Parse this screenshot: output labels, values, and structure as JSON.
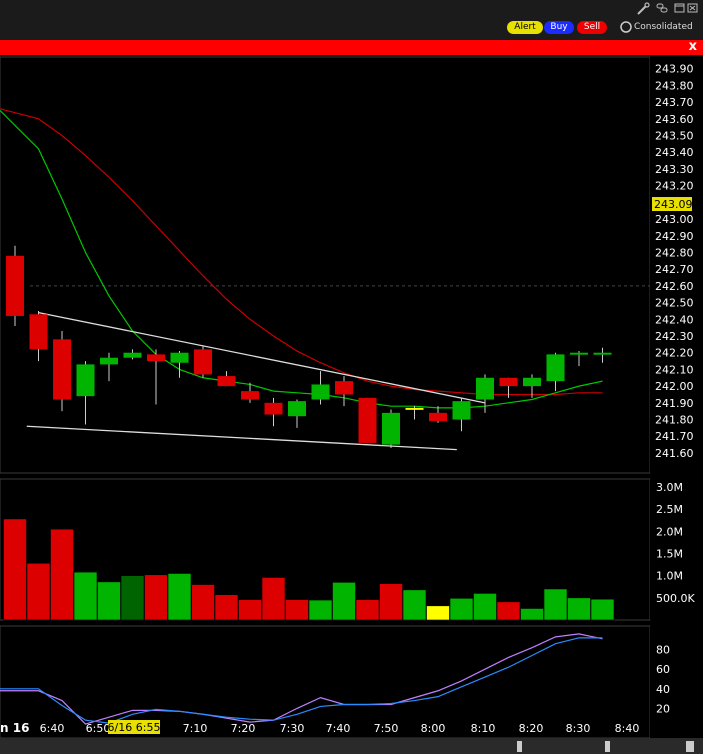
{
  "toolbar": {
    "alert_label": "Alert",
    "buy_label": "Buy",
    "sell_label": "Sell",
    "consolidated_label": "Consolidated",
    "close_glyph": "x"
  },
  "icons": [
    "wrench-icon",
    "link-icon",
    "window-icon",
    "close-icon"
  ],
  "colors": {
    "up": "#00b400",
    "down": "#dd0000",
    "ema_fast": "#00c800",
    "ema_slow": "#c80000",
    "stoch_k": "#c080ff",
    "stoch_d": "#2a8cff",
    "highlight": "#ffff00"
  },
  "chart_data": [
    {
      "type": "candlestick",
      "current_price": "243.09",
      "y_ticks": [
        "243.90",
        "243.80",
        "243.70",
        "243.60",
        "243.50",
        "243.40",
        "243.30",
        "243.20",
        "243.00",
        "242.90",
        "242.80",
        "242.70",
        "242.60",
        "242.50",
        "242.40",
        "242.30",
        "242.20",
        "242.10",
        "242.00",
        "241.90",
        "241.80",
        "241.70",
        "241.60"
      ],
      "ylim": [
        241.48,
        243.97
      ],
      "x_ticks": [
        "6:40",
        "6:50",
        "7:10",
        "7:20",
        "7:30",
        "7:40",
        "7:50",
        "8:00",
        "8:10",
        "8:20",
        "8:30",
        "8:40"
      ],
      "x_partial_label": "n 16",
      "crosshair_label": "6/16 6:55",
      "candles": [
        {
          "o": 242.78,
          "h": 242.84,
          "l": 242.36,
          "c": 242.42
        },
        {
          "o": 242.43,
          "h": 242.45,
          "l": 242.15,
          "c": 242.22
        },
        {
          "o": 242.28,
          "h": 242.33,
          "l": 241.85,
          "c": 241.92
        },
        {
          "o": 241.94,
          "h": 242.15,
          "l": 241.77,
          "c": 242.13
        },
        {
          "o": 242.13,
          "h": 242.2,
          "l": 242.03,
          "c": 242.17
        },
        {
          "o": 242.17,
          "h": 242.22,
          "l": 242.16,
          "c": 242.2
        },
        {
          "o": 242.19,
          "h": 242.22,
          "l": 241.89,
          "c": 242.15
        },
        {
          "o": 242.14,
          "h": 242.21,
          "l": 242.05,
          "c": 242.2
        },
        {
          "o": 242.22,
          "h": 242.24,
          "l": 242.05,
          "c": 242.07
        },
        {
          "o": 242.06,
          "h": 242.09,
          "l": 242.0,
          "c": 242.0
        },
        {
          "o": 241.97,
          "h": 242.02,
          "l": 241.9,
          "c": 241.92
        },
        {
          "o": 241.9,
          "h": 241.93,
          "l": 241.76,
          "c": 241.83
        },
        {
          "o": 241.82,
          "h": 241.92,
          "l": 241.75,
          "c": 241.91
        },
        {
          "o": 241.92,
          "h": 242.09,
          "l": 241.89,
          "c": 242.01
        },
        {
          "o": 242.03,
          "h": 242.06,
          "l": 241.88,
          "c": 241.95
        },
        {
          "o": 241.93,
          "h": 241.93,
          "l": 241.66,
          "c": 241.66
        },
        {
          "o": 241.65,
          "h": 241.86,
          "l": 241.63,
          "c": 241.84
        },
        {
          "o": 241.86,
          "h": 241.88,
          "l": 241.8,
          "c": 241.87
        },
        {
          "o": 241.84,
          "h": 241.88,
          "l": 241.78,
          "c": 241.79
        },
        {
          "o": 241.8,
          "h": 241.93,
          "l": 241.73,
          "c": 241.91
        },
        {
          "o": 241.92,
          "h": 242.07,
          "l": 241.84,
          "c": 242.05
        },
        {
          "o": 242.05,
          "h": 242.05,
          "l": 241.93,
          "c": 242.0
        },
        {
          "o": 242.0,
          "h": 242.07,
          "l": 241.93,
          "c": 242.05
        },
        {
          "o": 242.03,
          "h": 242.2,
          "l": 241.97,
          "c": 242.19
        },
        {
          "o": 242.19,
          "h": 242.21,
          "l": 242.12,
          "c": 242.2
        },
        {
          "o": 242.2,
          "h": 242.23,
          "l": 242.14,
          "c": 242.2
        }
      ],
      "ema_fast": [
        243.65,
        243.42,
        243.12,
        242.8,
        242.54,
        242.33,
        242.19,
        242.1,
        242.05,
        242.03,
        242.01,
        241.97,
        241.96,
        241.95,
        241.93,
        241.9,
        241.88,
        241.88,
        241.87,
        241.87,
        241.88,
        241.9,
        241.92,
        241.96,
        242.0,
        242.03
      ],
      "ema_slow": [
        243.66,
        243.6,
        243.5,
        243.38,
        243.25,
        243.11,
        242.96,
        242.81,
        242.66,
        242.52,
        242.4,
        242.3,
        242.21,
        242.14,
        242.08,
        242.03,
        242.0,
        241.98,
        241.97,
        241.96,
        241.95,
        241.95,
        241.95,
        241.95,
        241.96,
        241.96
      ],
      "trendlines": [
        {
          "from": [
            1,
            242.44
          ],
          "to": [
            20,
            241.9
          ]
        },
        {
          "from": [
            0.5,
            241.76
          ],
          "to": [
            18.8,
            241.62
          ]
        }
      ]
    },
    {
      "type": "bar",
      "y_ticks": [
        "3.0M",
        "2.5M",
        "2.0M",
        "1.5M",
        "1.0M",
        "500.0K"
      ],
      "ylim": [
        0,
        3.0
      ],
      "values": [
        2.28,
        1.28,
        2.05,
        1.08,
        0.86,
        1.0,
        1.02,
        1.05,
        0.8,
        0.57,
        0.46,
        0.96,
        0.46,
        0.45,
        0.85,
        0.46,
        0.82,
        0.68,
        0.32,
        0.49,
        0.6,
        0.41,
        0.26,
        0.7,
        0.5,
        0.47
      ],
      "dirs": [
        "d",
        "d",
        "d",
        "u",
        "u",
        "u",
        "d",
        "u",
        "d",
        "d",
        "d",
        "d",
        "d",
        "u",
        "u",
        "d",
        "d",
        "u",
        "y",
        "u",
        "u",
        "d",
        "u",
        "u",
        "u",
        "u"
      ]
    },
    {
      "type": "line",
      "y_ticks": [
        "80",
        "60",
        "40",
        "20"
      ],
      "ylim": [
        0,
        100
      ],
      "series": [
        {
          "values": [
            38,
            38,
            28,
            4,
            11,
            18,
            18,
            17,
            14,
            10,
            6,
            8,
            20,
            31,
            24,
            24,
            24,
            31,
            38,
            48,
            60,
            72,
            82,
            93,
            96,
            91
          ]
        },
        {
          "values": [
            40,
            40,
            23,
            8,
            5,
            14,
            19,
            17,
            14,
            11,
            9,
            8,
            14,
            22,
            24,
            24,
            25,
            28,
            32,
            42,
            52,
            62,
            74,
            86,
            92,
            92
          ]
        }
      ]
    }
  ]
}
